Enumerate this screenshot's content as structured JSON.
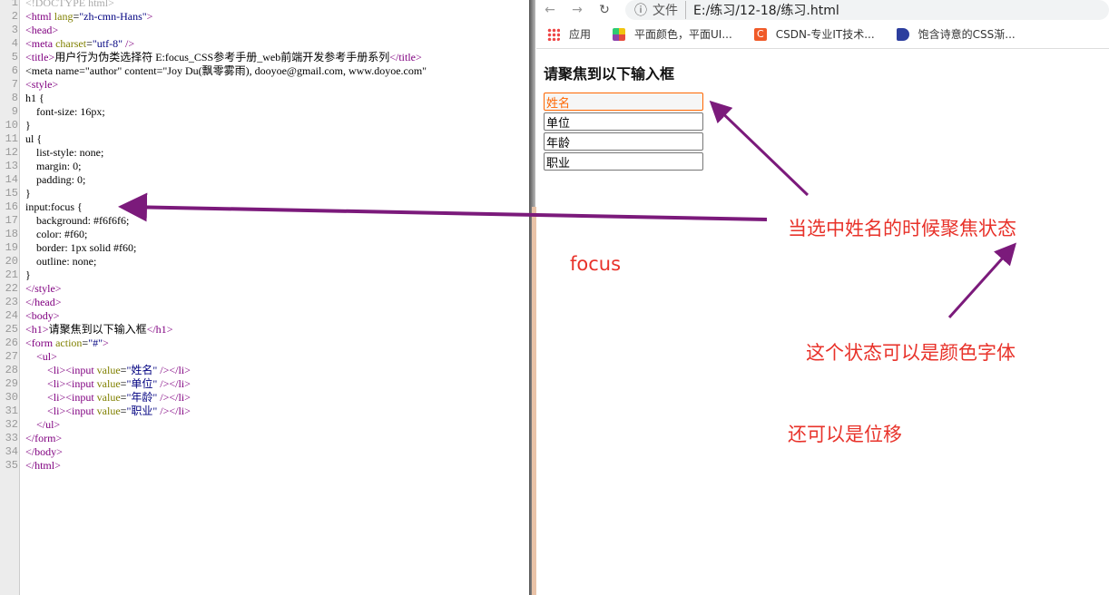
{
  "editor": {
    "lines": [
      "<!DOCTYPE html>",
      "<html lang=\"zh-cmn-Hans\">",
      "<head>",
      "<meta charset=\"utf-8\" />",
      "<title>用户行为伪类选择符 E:focus_CSS参考手册_web前端开发参考手册系列</title>",
      "<meta name=\"author\" content=\"Joy Du(飘零雾雨), dooyoe@gmail.com, www.doyoe.com\"",
      "<style>",
      "h1 {",
      "    font-size: 16px;",
      "}",
      "ul {",
      "    list-style: none;",
      "    margin: 0;",
      "    padding: 0;",
      "}",
      "input:focus {",
      "    background: #f6f6f6;",
      "    color: #f60;",
      "    border: 1px solid #f60;",
      "    outline: none;",
      "}",
      "</style>",
      "</head>",
      "<body>",
      "<h1>请聚焦到以下输入框</h1>",
      "<form action=\"#\">",
      "    <ul>",
      "        <li><input value=\"姓名\" /></li>",
      "        <li><input value=\"单位\" /></li>",
      "        <li><input value=\"年龄\" /></li>",
      "        <li><input value=\"职业\" /></li>",
      "    </ul>",
      "</form>",
      "</body>",
      "</html>"
    ]
  },
  "browser": {
    "back_icon": "arrow-left-icon",
    "forward_icon": "arrow-right-icon",
    "reload_icon": "reload-icon",
    "info_icon": "info-icon",
    "scheme_label": "文件",
    "url": "E:/练习/12-18/练习.html",
    "bookmarks": [
      {
        "label": "应用",
        "icon": "apps-grid-icon"
      },
      {
        "label": "平面颜色，平面UI...",
        "icon": "color-grid-icon"
      },
      {
        "label": "CSDN-专业IT技术...",
        "icon": "csdn-icon",
        "color": "#f05a28"
      },
      {
        "label": "饱含诗意的CSS渐...",
        "icon": "bookmark-icon",
        "color": "#2c3e9e"
      }
    ]
  },
  "page": {
    "heading": "请聚焦到以下输入框",
    "inputs": [
      "姓名",
      "单位",
      "年龄",
      "职业"
    ],
    "focus_color": "#f60"
  },
  "annotations": {
    "focus_state": "当选中姓名的时候聚焦状态",
    "focus": "focus",
    "color_font": "这个状态可以是颜色字体",
    "displacement": "还可以是位移",
    "text_color": "#e8322a",
    "arrow_color": "#7b1a7b"
  }
}
